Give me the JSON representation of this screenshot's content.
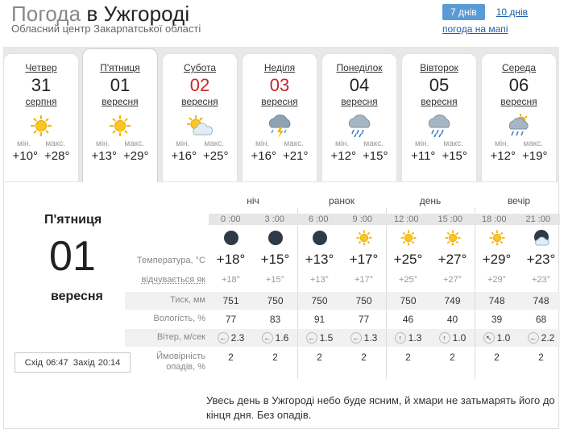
{
  "header": {
    "title_prefix": "Погода",
    "title_city": "в Ужгороді",
    "subtitle": "Обласний центр Закарпатської області",
    "tab_active": "7 днів",
    "tab_alt": "10 днів",
    "map_link": "погода на мапі"
  },
  "days": [
    {
      "name": "Четвер",
      "num": "31",
      "month": "серпня",
      "icon": "sun-icon",
      "min_label": "мін.",
      "max_label": "макс.",
      "min": "+10°",
      "max": "+28°",
      "red": false
    },
    {
      "name": "П'ятниця",
      "num": "01",
      "month": "вересня",
      "icon": "sun-icon",
      "min_label": "мін.",
      "max_label": "макс.",
      "min": "+13°",
      "max": "+29°",
      "red": false
    },
    {
      "name": "Субота",
      "num": "02",
      "month": "вересня",
      "icon": "sun-cloud-icon",
      "min_label": "мін.",
      "max_label": "макс.",
      "min": "+16°",
      "max": "+25°",
      "red": true
    },
    {
      "name": "Неділя",
      "num": "03",
      "month": "вересня",
      "icon": "thunderstorm-icon",
      "min_label": "мін.",
      "max_label": "макс.",
      "min": "+16°",
      "max": "+21°",
      "red": true
    },
    {
      "name": "Понеділок",
      "num": "04",
      "month": "вересня",
      "icon": "rain-cloud-icon",
      "min_label": "мін.",
      "max_label": "макс.",
      "min": "+12°",
      "max": "+15°",
      "red": false
    },
    {
      "name": "Вівторок",
      "num": "05",
      "month": "вересня",
      "icon": "rain-cloud-icon",
      "min_label": "мін.",
      "max_label": "макс.",
      "min": "+11°",
      "max": "+15°",
      "red": false
    },
    {
      "name": "Середа",
      "num": "06",
      "month": "вересня",
      "icon": "sun-cloud-rain-icon",
      "min_label": "мін.",
      "max_label": "макс.",
      "min": "+12°",
      "max": "+19°",
      "red": false
    }
  ],
  "detail": {
    "day_name": "П'ятниця",
    "day_num": "01",
    "day_month": "вересня",
    "sunrise_label": "Схід",
    "sunrise": "06:47",
    "sunset_label": "Захід",
    "sunset": "20:14",
    "periods": [
      "ніч",
      "ранок",
      "день",
      "вечір"
    ],
    "times": [
      "0 :00",
      "3 :00",
      "6 :00",
      "9 :00",
      "12 :00",
      "15 :00",
      "18 :00",
      "21 :00"
    ],
    "icons": [
      "moon-icon",
      "moon-icon",
      "moon-icon",
      "sun-icon",
      "sun-icon",
      "sun-icon",
      "sun-icon",
      "moon-cloud-icon"
    ],
    "labels": {
      "temp": "Температура, °C",
      "feels": "відчувається як",
      "pressure": "Тиск, мм",
      "humidity": "Вологість, %",
      "wind": "Вітер, м/сек",
      "precip1": "Ймовірність",
      "precip2": "опадів, %"
    },
    "temp": [
      "+18°",
      "+15°",
      "+13°",
      "+17°",
      "+25°",
      "+27°",
      "+29°",
      "+23°"
    ],
    "feels": [
      "+18°",
      "+15°",
      "+13°",
      "+17°",
      "+25°",
      "+27°",
      "+29°",
      "+23°"
    ],
    "pressure": [
      "751",
      "750",
      "750",
      "750",
      "750",
      "749",
      "748",
      "748"
    ],
    "humidity": [
      "77",
      "83",
      "91",
      "77",
      "46",
      "40",
      "39",
      "68"
    ],
    "wind": [
      {
        "dir": "←",
        "speed": "2.3"
      },
      {
        "dir": "←",
        "speed": "1.6"
      },
      {
        "dir": "←",
        "speed": "1.5"
      },
      {
        "dir": "←",
        "speed": "1.3"
      },
      {
        "dir": "↑",
        "speed": "1.3"
      },
      {
        "dir": "↑",
        "speed": "1.0"
      },
      {
        "dir": "↖",
        "speed": "1.0"
      },
      {
        "dir": "←",
        "speed": "2.2"
      }
    ],
    "precip": [
      "2",
      "2",
      "2",
      "2",
      "2",
      "2",
      "2",
      "2"
    ],
    "description": "Увесь день в Ужгороді небо буде ясним, й хмари не затьмарять його до кінця дня. Без опадів."
  },
  "colors": {
    "accent": "#5b9bd5",
    "link": "#1a5dab",
    "weekend": "#c62828",
    "sun": "#f4b400"
  }
}
